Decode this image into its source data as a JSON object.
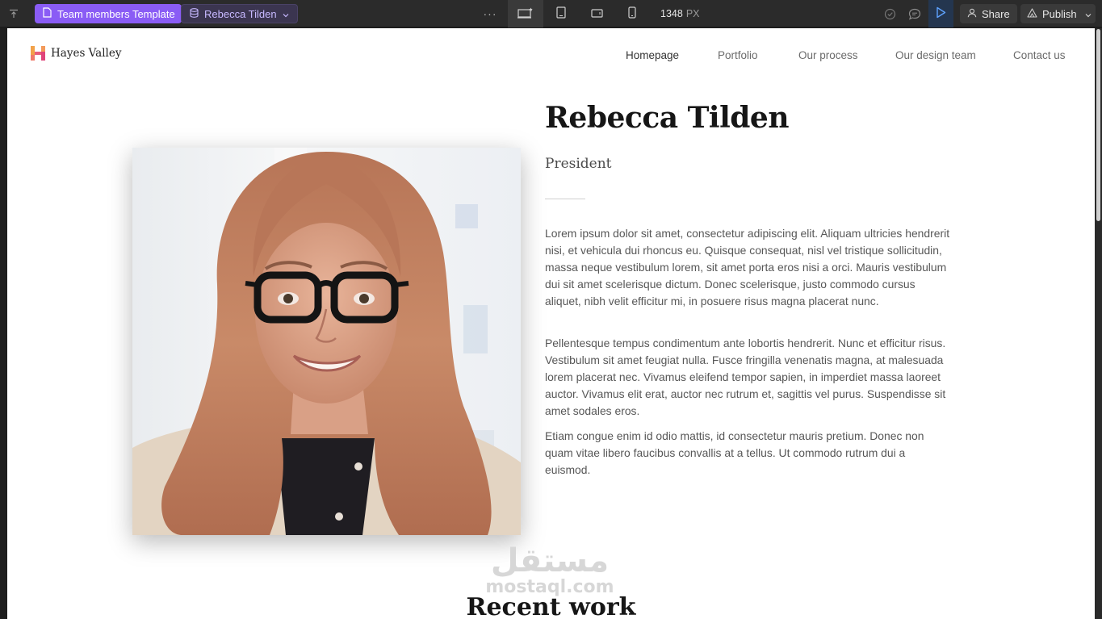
{
  "toolbar": {
    "page_label": "Team members Template",
    "item_label": "Rebecca Tilden",
    "more_label": "···",
    "width_value": "1348",
    "width_unit": "PX",
    "share_label": "Share",
    "publish_label": "Publish",
    "accent_color": "#8a5cf5"
  },
  "site": {
    "brand": "Hayes Valley",
    "nav": [
      "Homepage",
      "Portfolio",
      "Our process",
      "Our design team",
      "Contact us"
    ]
  },
  "member": {
    "name": "Rebecca Tilden",
    "role": "President",
    "bio": [
      "Lorem ipsum dolor sit amet, consectetur adipiscing elit. Aliquam ultricies hendrerit nisi, et vehicula dui rhoncus eu. Quisque consequat, nisl vel tristique sollicitudin, massa neque vestibulum lorem, sit amet porta eros nisi a orci. Mauris vestibulum dui sit amet scelerisque dictum. Donec scelerisque, justo commodo cursus aliquet, nibh velit efficitur mi, in posuere risus magna placerat nunc.",
      "Pellentesque tempus condimentum ante lobortis hendrerit. Nunc et efficitur risus. Vestibulum sit amet feugiat nulla. Fusce fringilla venenatis magna, at malesuada lorem placerat nec. Vivamus eleifend tempor sapien, in imperdiet massa laoreet auctor. Vivamus elit erat, auctor nec rutrum et, sagittis vel purus. Suspendisse sit amet sodales eros.",
      "Etiam congue enim id odio mattis, id consectetur mauris pretium. Donec non quam vitae libero faucibus convallis at a tellus. Ut commodo rutrum dui a euismod."
    ]
  },
  "watermark": {
    "arabic": "مستقل",
    "latin": "mostaql.com"
  },
  "recent_work": {
    "title": "Recent work"
  }
}
